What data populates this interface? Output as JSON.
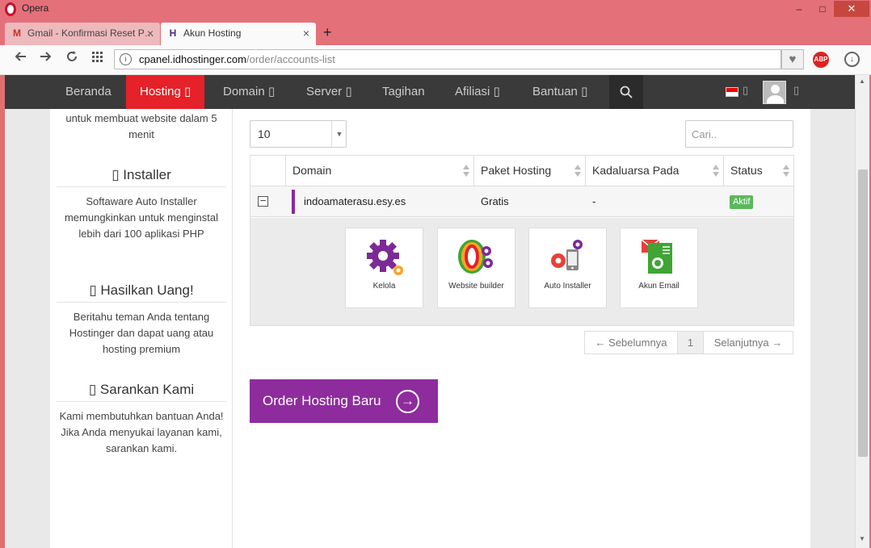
{
  "window": {
    "app_title": "Opera",
    "minimize": "–",
    "maximize": "□",
    "close": "✕"
  },
  "tabs": [
    {
      "label": "Gmail - Konfirmasi Reset P…",
      "icon": "gmail-icon",
      "close": "×"
    },
    {
      "label": "Akun Hosting",
      "icon": "hostinger-icon",
      "close": "×"
    }
  ],
  "new_tab": "+",
  "address": {
    "host": "cpanel.idhostinger.com",
    "path": "/order/accounts-list"
  },
  "nav": {
    "items": [
      {
        "label": "Beranda",
        "caret": ""
      },
      {
        "label": "Hosting",
        "caret": "▯"
      },
      {
        "label": "Domain",
        "caret": "▯"
      },
      {
        "label": "Server",
        "caret": "▯"
      },
      {
        "label": "Tagihan",
        "caret": ""
      },
      {
        "label": "Afiliasi",
        "caret": "▯"
      },
      {
        "label": "Bantuan",
        "caret": "▯"
      }
    ],
    "search_icon": "search-icon",
    "flag_caret": "▯",
    "avatar_caret": "▯"
  },
  "sidebar": {
    "intro": "untuk membuat website dalam 5 menit",
    "sections": [
      {
        "title": "▯ Installer",
        "text": "Softaware Auto Installer memungkinkan untuk menginstal lebih dari 100 aplikasi PHP"
      },
      {
        "title": "▯ Hasilkan Uang!",
        "text": "Beritahu teman Anda tentang Hostinger dan dapat uang atau hosting premium"
      },
      {
        "title": "▯ Sarankan Kami",
        "text": "Kami membutuhkan bantuan Anda! Jika Anda menyukai layanan kami, sarankan kami."
      }
    ]
  },
  "table_controls": {
    "page_size": "10",
    "search_placeholder": "Cari.."
  },
  "table": {
    "headers": [
      "Domain",
      "Paket Hosting",
      "Kadaluarsa Pada",
      "Status"
    ],
    "rows": [
      {
        "toggle": "−",
        "domain": "indoamaterasu.esy.es",
        "package": "Gratis",
        "expires": "-",
        "status": "Aktif"
      }
    ],
    "actions": [
      {
        "label": "Kelola",
        "icon": "gear-icon"
      },
      {
        "label": "Website builder",
        "icon": "website-builder-icon"
      },
      {
        "label": "Auto Installer",
        "icon": "auto-installer-icon"
      },
      {
        "label": "Akun Email",
        "icon": "email-account-icon"
      }
    ]
  },
  "pagination": {
    "prev": "← Sebelumnya",
    "current": "1",
    "next": "Selanjutnya →"
  },
  "order_button": {
    "label": "Order Hosting Baru",
    "arrow": "→"
  },
  "colors": {
    "nav_bg": "#3a3a3a",
    "nav_active": "#e52129",
    "brand_purple": "#8e2c9e",
    "status_green": "#5cb85c"
  }
}
